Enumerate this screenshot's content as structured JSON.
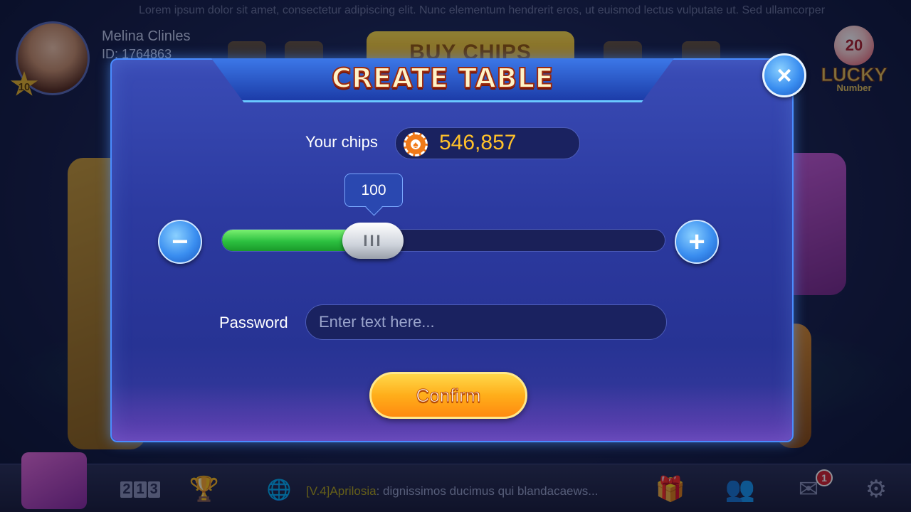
{
  "marquee": "Lorem ipsum dolor sit amet, consectetur adipiscing elit. Nunc elementum hendrerit eros, ut euismod lectus vulputate ut. Sed ullamcorper",
  "player": {
    "name": "Melina Clinles",
    "id": "ID: 1764863",
    "level": "10"
  },
  "top_bar": {
    "buy_chips": "BUY CHIPS",
    "lucky_ball": "20",
    "lucky_title": "LUCKY",
    "lucky_sub": "Number"
  },
  "dialog": {
    "title": "CREATE TABLE",
    "close_icon": "×",
    "chips_label": "Your chips",
    "chips_value": "546,857",
    "chip_icon": "♠",
    "slider": {
      "value": "100",
      "fill_fraction": 0.3,
      "minus_icon": "−",
      "plus_icon": "+",
      "handle_icon": "III"
    },
    "password_label": "Password",
    "password_placeholder": "Enter text here...",
    "confirm_label": "Confirm"
  },
  "bottom_bar": {
    "rank_digits": [
      "2",
      "1",
      "3"
    ],
    "trophy_icon": "🏆",
    "globe_icon": "🌐",
    "chat_sender": "[V.4]Aprilosia",
    "chat_message": ": dignissimos ducimus qui blandacaews...",
    "gift_icon": "🎁",
    "friends_icon": "👥",
    "mail_icon": "✉",
    "mail_count": "1",
    "settings_icon": "⚙"
  },
  "colors": {
    "dialog_bg": "#2c3aa0",
    "accent_blue": "#3a8ef0",
    "chips_gold": "#ffc12a",
    "slider_green": "#2cc040",
    "confirm_orange": "#ffae1a"
  }
}
